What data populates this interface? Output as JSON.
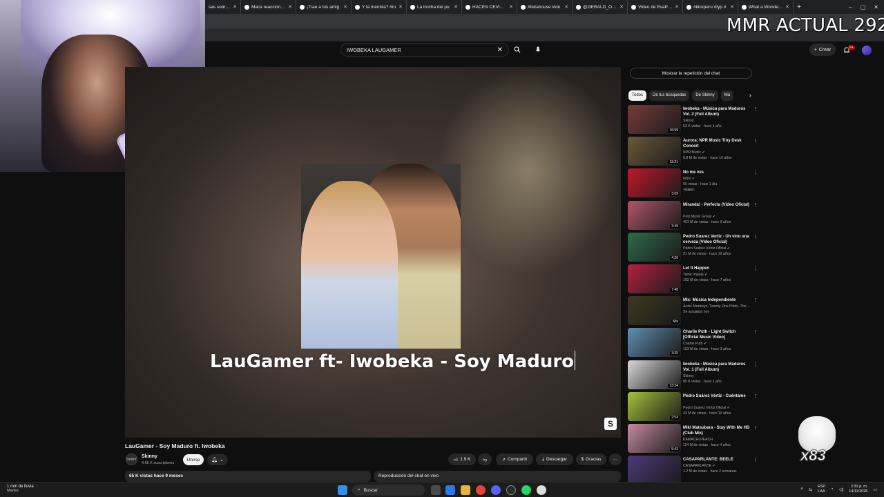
{
  "overlay": {
    "mmr_text": "MMR ACTUAL 292",
    "sticker_count": "x83"
  },
  "browser": {
    "tabs": [
      {
        "label": "sas sobre m"
      },
      {
        "label": "Maca reacciona a"
      },
      {
        "label": "¡Trae a tus amig"
      },
      {
        "label": "Y la mentira? #m"
      },
      {
        "label": "La trocha del pu"
      },
      {
        "label": "HACEN CEVICHE"
      },
      {
        "label": "#fekahouse #kin"
      },
      {
        "label": "@GERALD_ORO"
      },
      {
        "label": "Video de EvaPart"
      },
      {
        "label": "#kickperu #fyp #"
      },
      {
        "label": "What a Wonderfu"
      }
    ],
    "new_tab": "+",
    "window_controls": [
      "–",
      "▢",
      "✕"
    ]
  },
  "youtube": {
    "search_value": "IWOBEKA LAUGAMER",
    "create_label": "Crear",
    "notification_count": "9+",
    "video": {
      "overlay_title": "LauGamer ft- Iwobeka - Soy Maduro",
      "title": "LauGamer - Soy Maduro ft. Iwobeka",
      "channel_avatar_text": "SKINY",
      "channel": "Skinny",
      "subscribers": "4.65 K suscriptores",
      "join_label": "Unirse",
      "likes": "1.9 K",
      "share_label": "Compartir",
      "download_label": "Descargar",
      "thanks_label": "Gracias",
      "views_meta": "65 K vistas  hace 9 meses",
      "chat_replay_label": "Reproducción del chat en vivo"
    },
    "rail": {
      "show_chat_replay": "Mostrar la repetición del chat",
      "chips": [
        {
          "label": "Todos",
          "active": true
        },
        {
          "label": "De tus búsquedas",
          "active": false
        },
        {
          "label": "De Skinny",
          "active": false
        },
        {
          "label": "Má",
          "active": false
        }
      ],
      "recommendations": [
        {
          "title": "Iwobeka - Música para Maduros Vol. 2 (Full Album)",
          "channel": "Skinny",
          "meta": "53 K vistas · hace 1 año",
          "duration": "16:59",
          "thumb": "#7a3b3b",
          "verified": false,
          "badge": ""
        },
        {
          "title": "Aurora: NPR Music Tiny Desk Concert",
          "channel": "NPR Music",
          "meta": "8.8 M de vistas · hace 10 años",
          "duration": "13:21",
          "thumb": "#6b5a3a",
          "verified": true,
          "badge": ""
        },
        {
          "title": "No me ves",
          "channel": "Filtro",
          "meta": "65 vistas · hace 1 día",
          "duration": "3:09",
          "thumb": "#c2182b",
          "verified": true,
          "badge": "Nuevo"
        },
        {
          "title": "Miranda! - Perfecta (Video Oficial)",
          "channel": "Pelo Music Group",
          "meta": "491 M de vistas · hace 9 años",
          "duration": "3:49",
          "thumb": "#b0566a",
          "verified": true,
          "badge": ""
        },
        {
          "title": "Pedro Suarez Vertiz - Un vino una cerveza (Video Oficial)",
          "channel": "Pedro Suárez Vértiz Oficial",
          "meta": "31 M de vistas · hace 10 años",
          "duration": "4:20",
          "thumb": "#2f6a4a",
          "verified": true,
          "badge": ""
        },
        {
          "title": "Let It Happen",
          "channel": "Tame Impala",
          "meta": "102 M de vistas · hace 7 años",
          "duration": "7:48",
          "thumb": "#b3223f",
          "verified": true,
          "badge": ""
        },
        {
          "title": "Mix: Música Independiente",
          "channel": "Arctic Monkeys, Twenty One Pilots, The ...",
          "meta": "Se actualizó hoy",
          "duration": "Mix",
          "thumb": "#3a3a20",
          "verified": false,
          "badge": ""
        },
        {
          "title": "Charlie Puth - Light Switch [Official Music Video]",
          "channel": "Charlie Puth",
          "meta": "193 M de vistas · hace 3 años",
          "duration": "3:25",
          "thumb": "#5f8fb0",
          "verified": true,
          "badge": ""
        },
        {
          "title": "Iwobeka - Música para Maduros Vol. 1 (Full Album)",
          "channel": "Skinny",
          "meta": "85 K vistas · hace 1 año",
          "duration": "23:34",
          "thumb": "#d8d8d8",
          "verified": false,
          "badge": ""
        },
        {
          "title": "Pedro Suárez Vértiz - Cuéntame",
          "channel": "Pedro Suárez Vértiz Oficial",
          "meta": "43 M de vistas · hace 10 años",
          "duration": "2:54",
          "thumb": "#a6c23a",
          "verified": true,
          "badge": ""
        },
        {
          "title": "Miki Matsubara - Stay With Me HD (Club Mix)",
          "channel": "KAMACHI PEACH",
          "meta": "114 M de vistas · hace 4 años",
          "duration": "5:43",
          "thumb": "#c58aa0",
          "verified": false,
          "badge": ""
        },
        {
          "title": "CASAPARLANTE: BEÉLE",
          "channel": "CASAPARLANTE",
          "meta": "1.2 M de vistas · hace 2 semanas",
          "duration": "",
          "thumb": "#4d3a7a",
          "verified": true,
          "badge": ""
        }
      ]
    }
  },
  "taskbar": {
    "weather_line1": "1 mm de lluvia",
    "weather_line2": "Martes",
    "search_label": "Buscar",
    "lang_line1": "ESP",
    "lang_line2": "LAA",
    "time": "2:31 p. m.",
    "date": "14/11/2025"
  }
}
